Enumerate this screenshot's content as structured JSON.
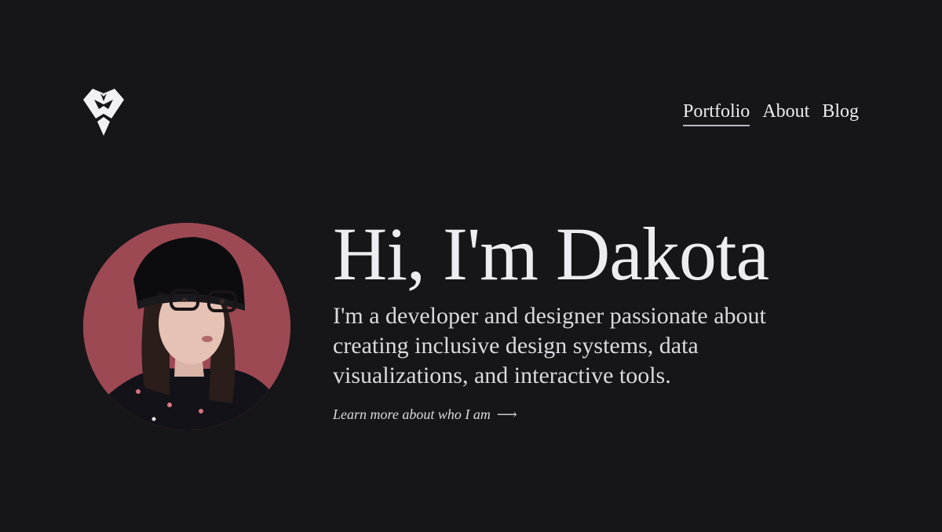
{
  "header": {
    "logo_icon": "diamond-monogram-logo-icon",
    "nav": [
      {
        "label": "Portfolio",
        "active": true
      },
      {
        "label": "About",
        "active": false
      },
      {
        "label": "Blog",
        "active": false
      }
    ]
  },
  "hero": {
    "avatar_icon": "portrait-photo",
    "title": "Hi, I'm Dakota",
    "intro": "I'm a developer and designer passionate about creating inclusive design systems, data visualizations, and interactive tools.",
    "learn_more": "Learn more about who I am",
    "arrow_icon": "long-arrow-right-icon"
  },
  "colors": {
    "background": "#161618",
    "text": "#ececf1",
    "avatar_bg": "#9e4a55"
  }
}
